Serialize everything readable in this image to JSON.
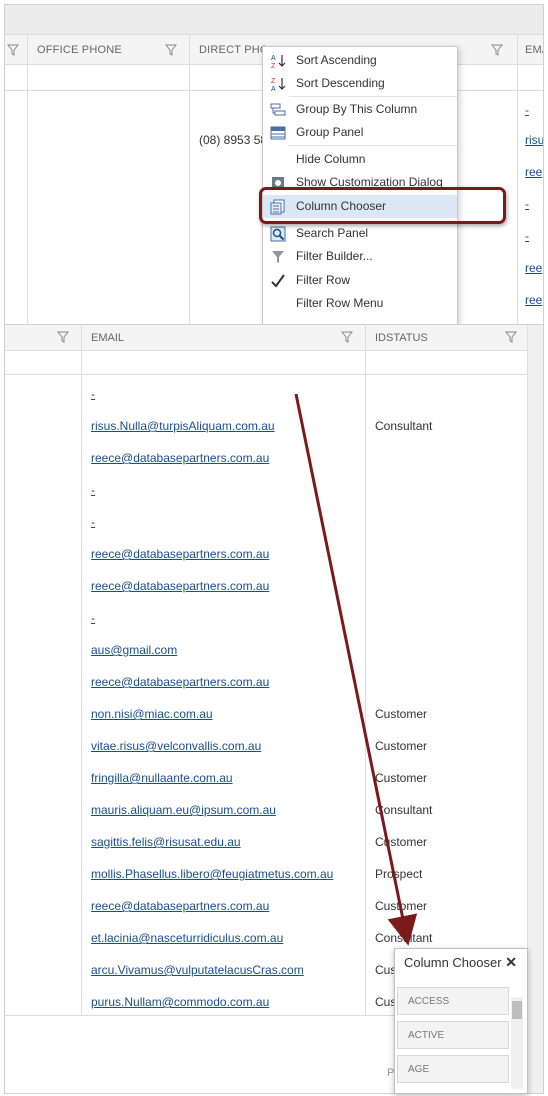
{
  "top_grid": {
    "headers": {
      "office_phone": "OFFICE PHONE",
      "direct_phone": "DIRECT PHONE",
      "email_partial": "EMA"
    },
    "direct_phone_value": "(08) 8953 58",
    "email_partials": [
      "-",
      "risu",
      "ree",
      "-",
      "-",
      "ree",
      "ree"
    ]
  },
  "context_menu": {
    "items": [
      {
        "label": "Sort Ascending",
        "icon": "sort-ascending-icon"
      },
      {
        "label": "Sort Descending",
        "icon": "sort-descending-icon"
      },
      {
        "label": "Group By This Column",
        "icon": "group-by-icon"
      },
      {
        "label": "Group Panel",
        "icon": "group-panel-icon"
      },
      {
        "label": "Hide Column",
        "icon": ""
      },
      {
        "label": "Show Customization Dialog",
        "icon": "customization-icon"
      },
      {
        "label": "Column Chooser",
        "icon": "column-chooser-icon"
      },
      {
        "label": "Search Panel",
        "icon": "search-panel-icon"
      },
      {
        "label": "Filter Builder...",
        "icon": "filter-builder-icon"
      },
      {
        "label": "Filter Row",
        "icon": "checkmark-icon"
      },
      {
        "label": "Filter Row Menu",
        "icon": ""
      }
    ],
    "highlighted": "Column Chooser"
  },
  "bottom_grid": {
    "headers": {
      "email": "EMAIL",
      "idstatus": "IDSTATUS"
    },
    "rows": [
      {
        "email": "-",
        "status": ""
      },
      {
        "email": "risus.Nulla@turpisAliquam.com.au",
        "status": "Consultant"
      },
      {
        "email": "reece@databasepartners.com.au",
        "status": ""
      },
      {
        "email": "-",
        "status": ""
      },
      {
        "email": "-",
        "status": ""
      },
      {
        "email": "reece@databasepartners.com.au",
        "status": ""
      },
      {
        "email": "reece@databasepartners.com.au",
        "status": ""
      },
      {
        "email": "-",
        "status": ""
      },
      {
        "email": "aus@gmail.com",
        "status": ""
      },
      {
        "email": "reece@databasepartners.com.au",
        "status": ""
      },
      {
        "email": "non.nisi@miac.com.au",
        "status": "Customer"
      },
      {
        "email": "vitae.risus@velconvallis.com.au",
        "status": "Customer"
      },
      {
        "email": "fringilla@nullaante.com.au",
        "status": "Customer"
      },
      {
        "email": "mauris.aliquam.eu@ipsum.com.au",
        "status": "Consultant"
      },
      {
        "email": "sagittis.felis@risusat.edu.au",
        "status": "Customer"
      },
      {
        "email": "mollis.Phasellus.libero@feugiatmetus.com.au",
        "status": "Prospect"
      },
      {
        "email": "reece@databasepartners.com.au",
        "status": "Customer"
      },
      {
        "email": "et.lacinia@nasceturridiculus.com.au",
        "status": "Consultant"
      },
      {
        "email": "arcu.Vivamus@vulputatelacusCras.com",
        "status": "Cus"
      },
      {
        "email": "purus.Nullam@commodo.com.au",
        "status": "Cus"
      }
    ],
    "footer_partial": "P"
  },
  "column_chooser": {
    "title": "Column Chooser",
    "close_icon": "close-icon",
    "items": [
      "ACCESS",
      "ACTIVE",
      "AGE"
    ]
  },
  "colors": {
    "link": "#1a4f8a",
    "callout": "#7b1a1a",
    "menu_highlight": "#dbe7f5"
  }
}
